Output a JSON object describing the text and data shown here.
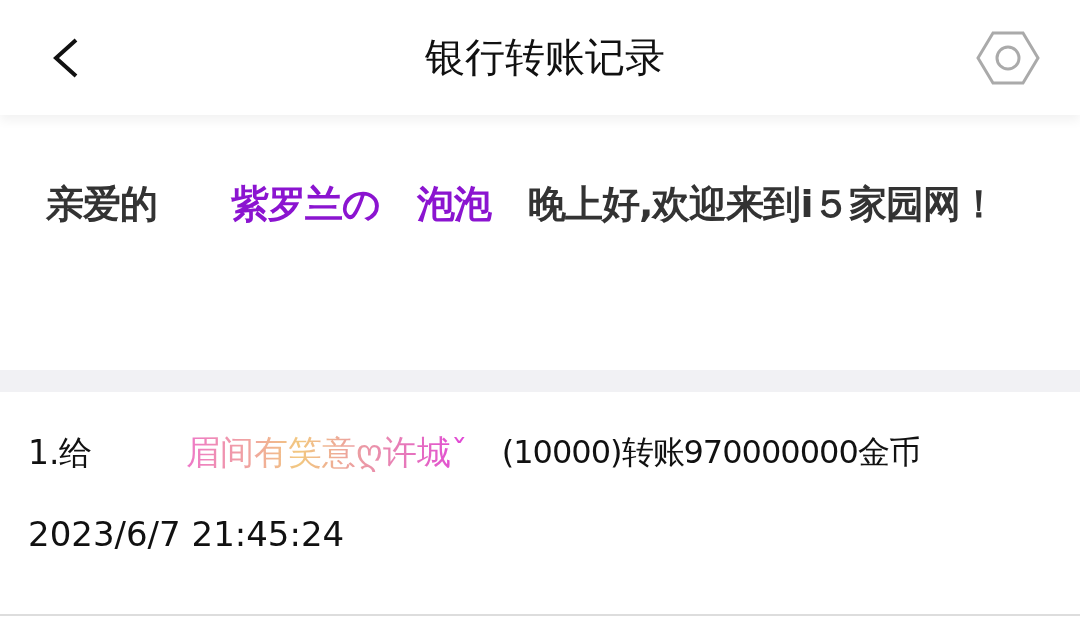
{
  "header": {
    "title": "银行转账记录"
  },
  "greeting": {
    "prefix": "亲爱的　　",
    "name": "紫罗兰の　泡泡",
    "suffix": "　晚上好,欢迎来到i５家园网！"
  },
  "records": [
    {
      "index": "1.给",
      "recipient": "眉间有笑意ღ许城ˇ",
      "detail": "(10000)转账970000000金币",
      "time": "2023/6/7 21:45:24"
    }
  ]
}
